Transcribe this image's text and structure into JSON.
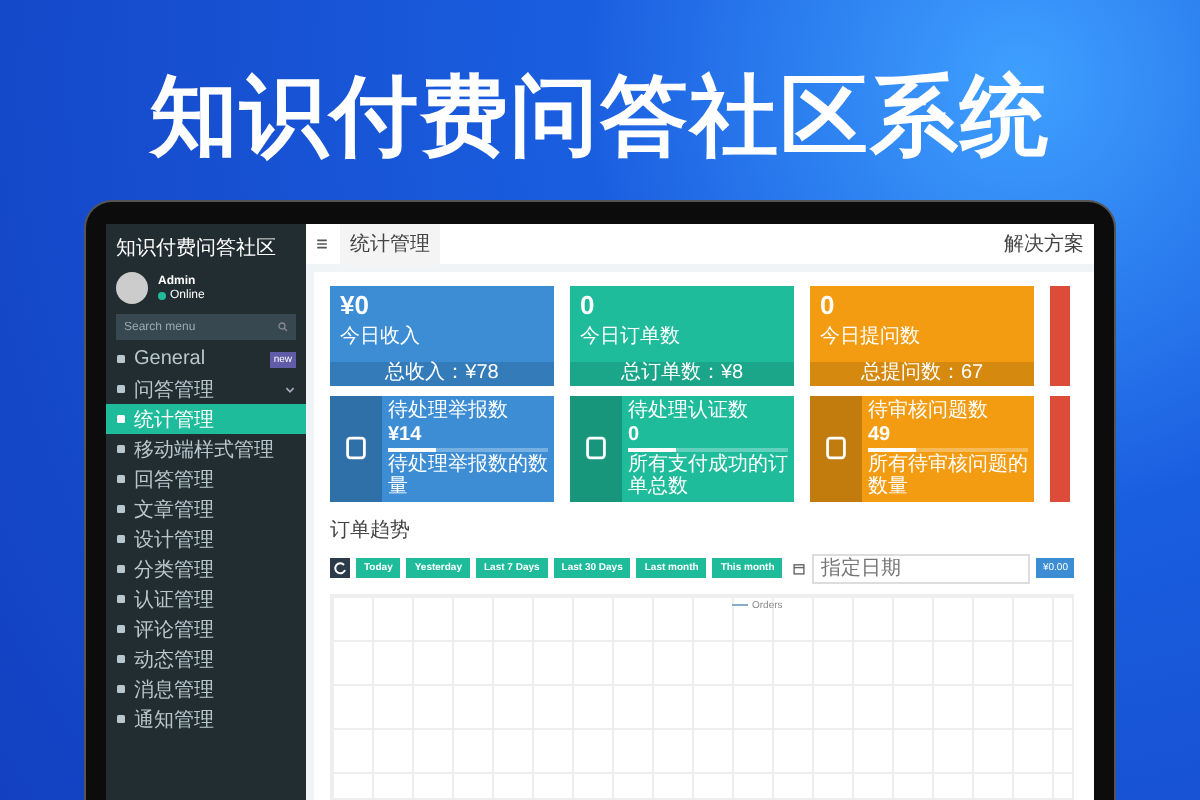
{
  "headline": "知识付费问答社区系统",
  "sidebar": {
    "brand": "知识付费问答社区",
    "user": {
      "name": "Admin",
      "status": "Online",
      "online": true
    },
    "search": {
      "placeholder": "Search menu"
    },
    "items": [
      {
        "label": "General",
        "badge": "new",
        "expandable": false,
        "selected": false
      },
      {
        "label": "问答管理",
        "expandable": true,
        "selected": false
      },
      {
        "label": "统计管理",
        "expandable": false,
        "selected": true
      },
      {
        "label": "移动端样式管理",
        "expandable": false,
        "selected": false
      },
      {
        "label": "回答管理",
        "expandable": false,
        "selected": false
      },
      {
        "label": "文章管理",
        "expandable": false,
        "selected": false
      },
      {
        "label": "设计管理",
        "expandable": false,
        "selected": false
      },
      {
        "label": "分类管理",
        "expandable": false,
        "selected": false
      },
      {
        "label": "认证管理",
        "expandable": false,
        "selected": false
      },
      {
        "label": "评论管理",
        "expandable": false,
        "selected": false
      },
      {
        "label": "动态管理",
        "expandable": false,
        "selected": false
      },
      {
        "label": "消息管理",
        "expandable": false,
        "selected": false
      },
      {
        "label": "通知管理",
        "expandable": false,
        "selected": false
      }
    ]
  },
  "header": {
    "tab": "统计管理",
    "right_link": "解决方案"
  },
  "stat_cards": [
    {
      "value": "¥0",
      "label": "今日收入",
      "footer": "总收入：¥78",
      "color": "#3c8dd4"
    },
    {
      "value": "0",
      "label": "今日订单数",
      "footer": "总订单数：¥8",
      "color": "#1fbc9c"
    },
    {
      "value": "0",
      "label": "今日提问数",
      "footer": "总提问数：67",
      "color": "#f39c12"
    }
  ],
  "info_cards": [
    {
      "title": "待处理举报数",
      "value": "¥14",
      "level": 0.3,
      "footer": "待处理举报数的数量",
      "color": "#3c8dd4"
    },
    {
      "title": "待处理认证数",
      "value": "0",
      "level": 0.3,
      "footer": "所有支付成功的订单总数",
      "color": "#1fbc9c"
    },
    {
      "title": "待审核问题数",
      "value": "49",
      "level": 0.3,
      "footer": "所有待审核问题的数量",
      "color": "#f39c12"
    }
  ],
  "trend": {
    "title": "订单趋势",
    "ranges": [
      "Today",
      "Yesterday",
      "Last 7 Days",
      "Last 30 Days",
      "Last month",
      "This month"
    ],
    "date": {
      "placeholder": "指定日期"
    },
    "total_button": "¥0.00",
    "legend": "Orders"
  }
}
